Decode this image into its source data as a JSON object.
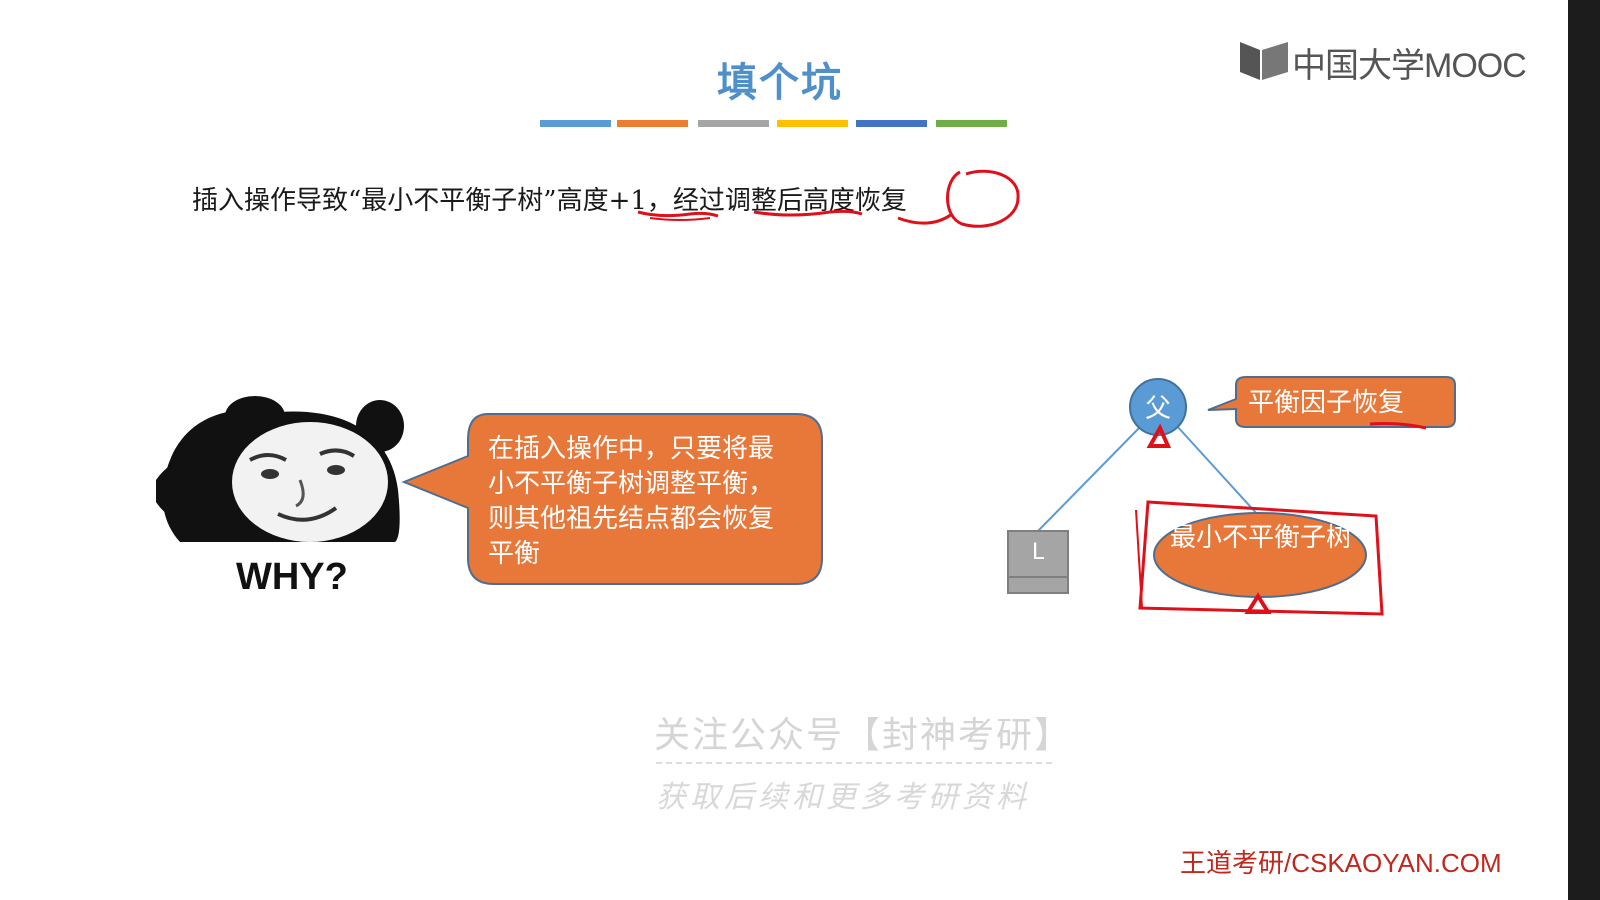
{
  "slide": {
    "title": "填个坑",
    "title_bar_colors": [
      "#5b9bd5",
      "#ed7d31",
      "#a5a5a5",
      "#ffc000",
      "#4472c4",
      "#70ad47"
    ],
    "logo_text": "中国大学MOOC",
    "intro_text": "插入操作导致“最小不平衡子树”高度+1，经过调整后高度恢复",
    "meme_caption": "WHY?",
    "speech_bubble_text": "在插入操作中，只要将最小不平衡子树调整平衡，则其他祖先结点都会恢复平衡",
    "tree": {
      "parent_node": "父",
      "left_node": "L",
      "subtree_node": "最小不平衡子树",
      "callout": "平衡因子恢复"
    },
    "watermark_line1": "关注公众号【封神考研】",
    "watermark_line2": "获取后续和更多考研资料",
    "footer": "王道考研/CSKAOYAN.COM"
  },
  "colors": {
    "title": "#4f8fca",
    "orange_fill": "#e8773a",
    "blue_node": "#5b9bd5",
    "gray_node": "#a5a5a5",
    "annotation_red": "#e0101a",
    "footer_red": "#c0281e"
  }
}
